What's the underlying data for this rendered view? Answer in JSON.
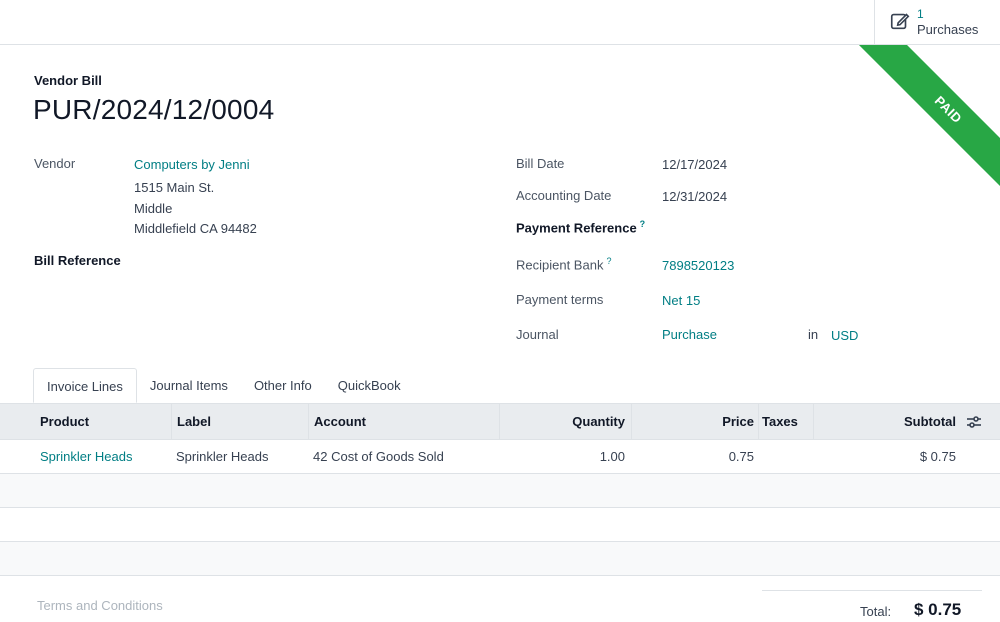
{
  "smart_button": {
    "count": "1",
    "label": "Purchases",
    "icon": "pencil-square-icon"
  },
  "status_ribbon": {
    "text": "PAID",
    "color": "#28a745"
  },
  "document": {
    "type": "Vendor Bill",
    "name": "PUR/2024/12/0004"
  },
  "vendor": {
    "label": "Vendor",
    "name": "Computers by Jenni",
    "address_line1": "1515 Main St.",
    "address_line2": "Middle",
    "address_line3": "Middlefield CA 94482"
  },
  "bill_reference": {
    "label": "Bill Reference",
    "value": ""
  },
  "bill_date": {
    "label": "Bill Date",
    "value": "12/17/2024"
  },
  "accounting_date": {
    "label": "Accounting Date",
    "value": "12/31/2024"
  },
  "payment_reference": {
    "label": "Payment Reference",
    "help": "?",
    "value": ""
  },
  "recipient_bank": {
    "label": "Recipient Bank",
    "help": "?",
    "value": "7898520123"
  },
  "payment_terms": {
    "label": "Payment terms",
    "value": "Net 15"
  },
  "journal": {
    "label": "Journal",
    "value": "Purchase",
    "in_label": "in",
    "currency": "USD"
  },
  "tabs": [
    {
      "label": "Invoice Lines",
      "active": true
    },
    {
      "label": "Journal Items",
      "active": false
    },
    {
      "label": "Other Info",
      "active": false
    },
    {
      "label": "QuickBook",
      "active": false
    }
  ],
  "lines_table": {
    "headers": {
      "product": "Product",
      "label": "Label",
      "account": "Account",
      "quantity": "Quantity",
      "price": "Price",
      "taxes": "Taxes",
      "subtotal": "Subtotal"
    },
    "rows": [
      {
        "product": "Sprinkler Heads",
        "label": "Sprinkler Heads",
        "account": "42 Cost of Goods Sold",
        "quantity": "1.00",
        "price": "0.75",
        "taxes": "",
        "subtotal": "$ 0.75"
      }
    ]
  },
  "footer": {
    "terms_placeholder": "Terms and Conditions",
    "total_label": "Total:",
    "total_value": "$ 0.75"
  },
  "colors": {
    "link": "#017e84",
    "header_bg": "#e9ecef",
    "text": "#374151"
  }
}
